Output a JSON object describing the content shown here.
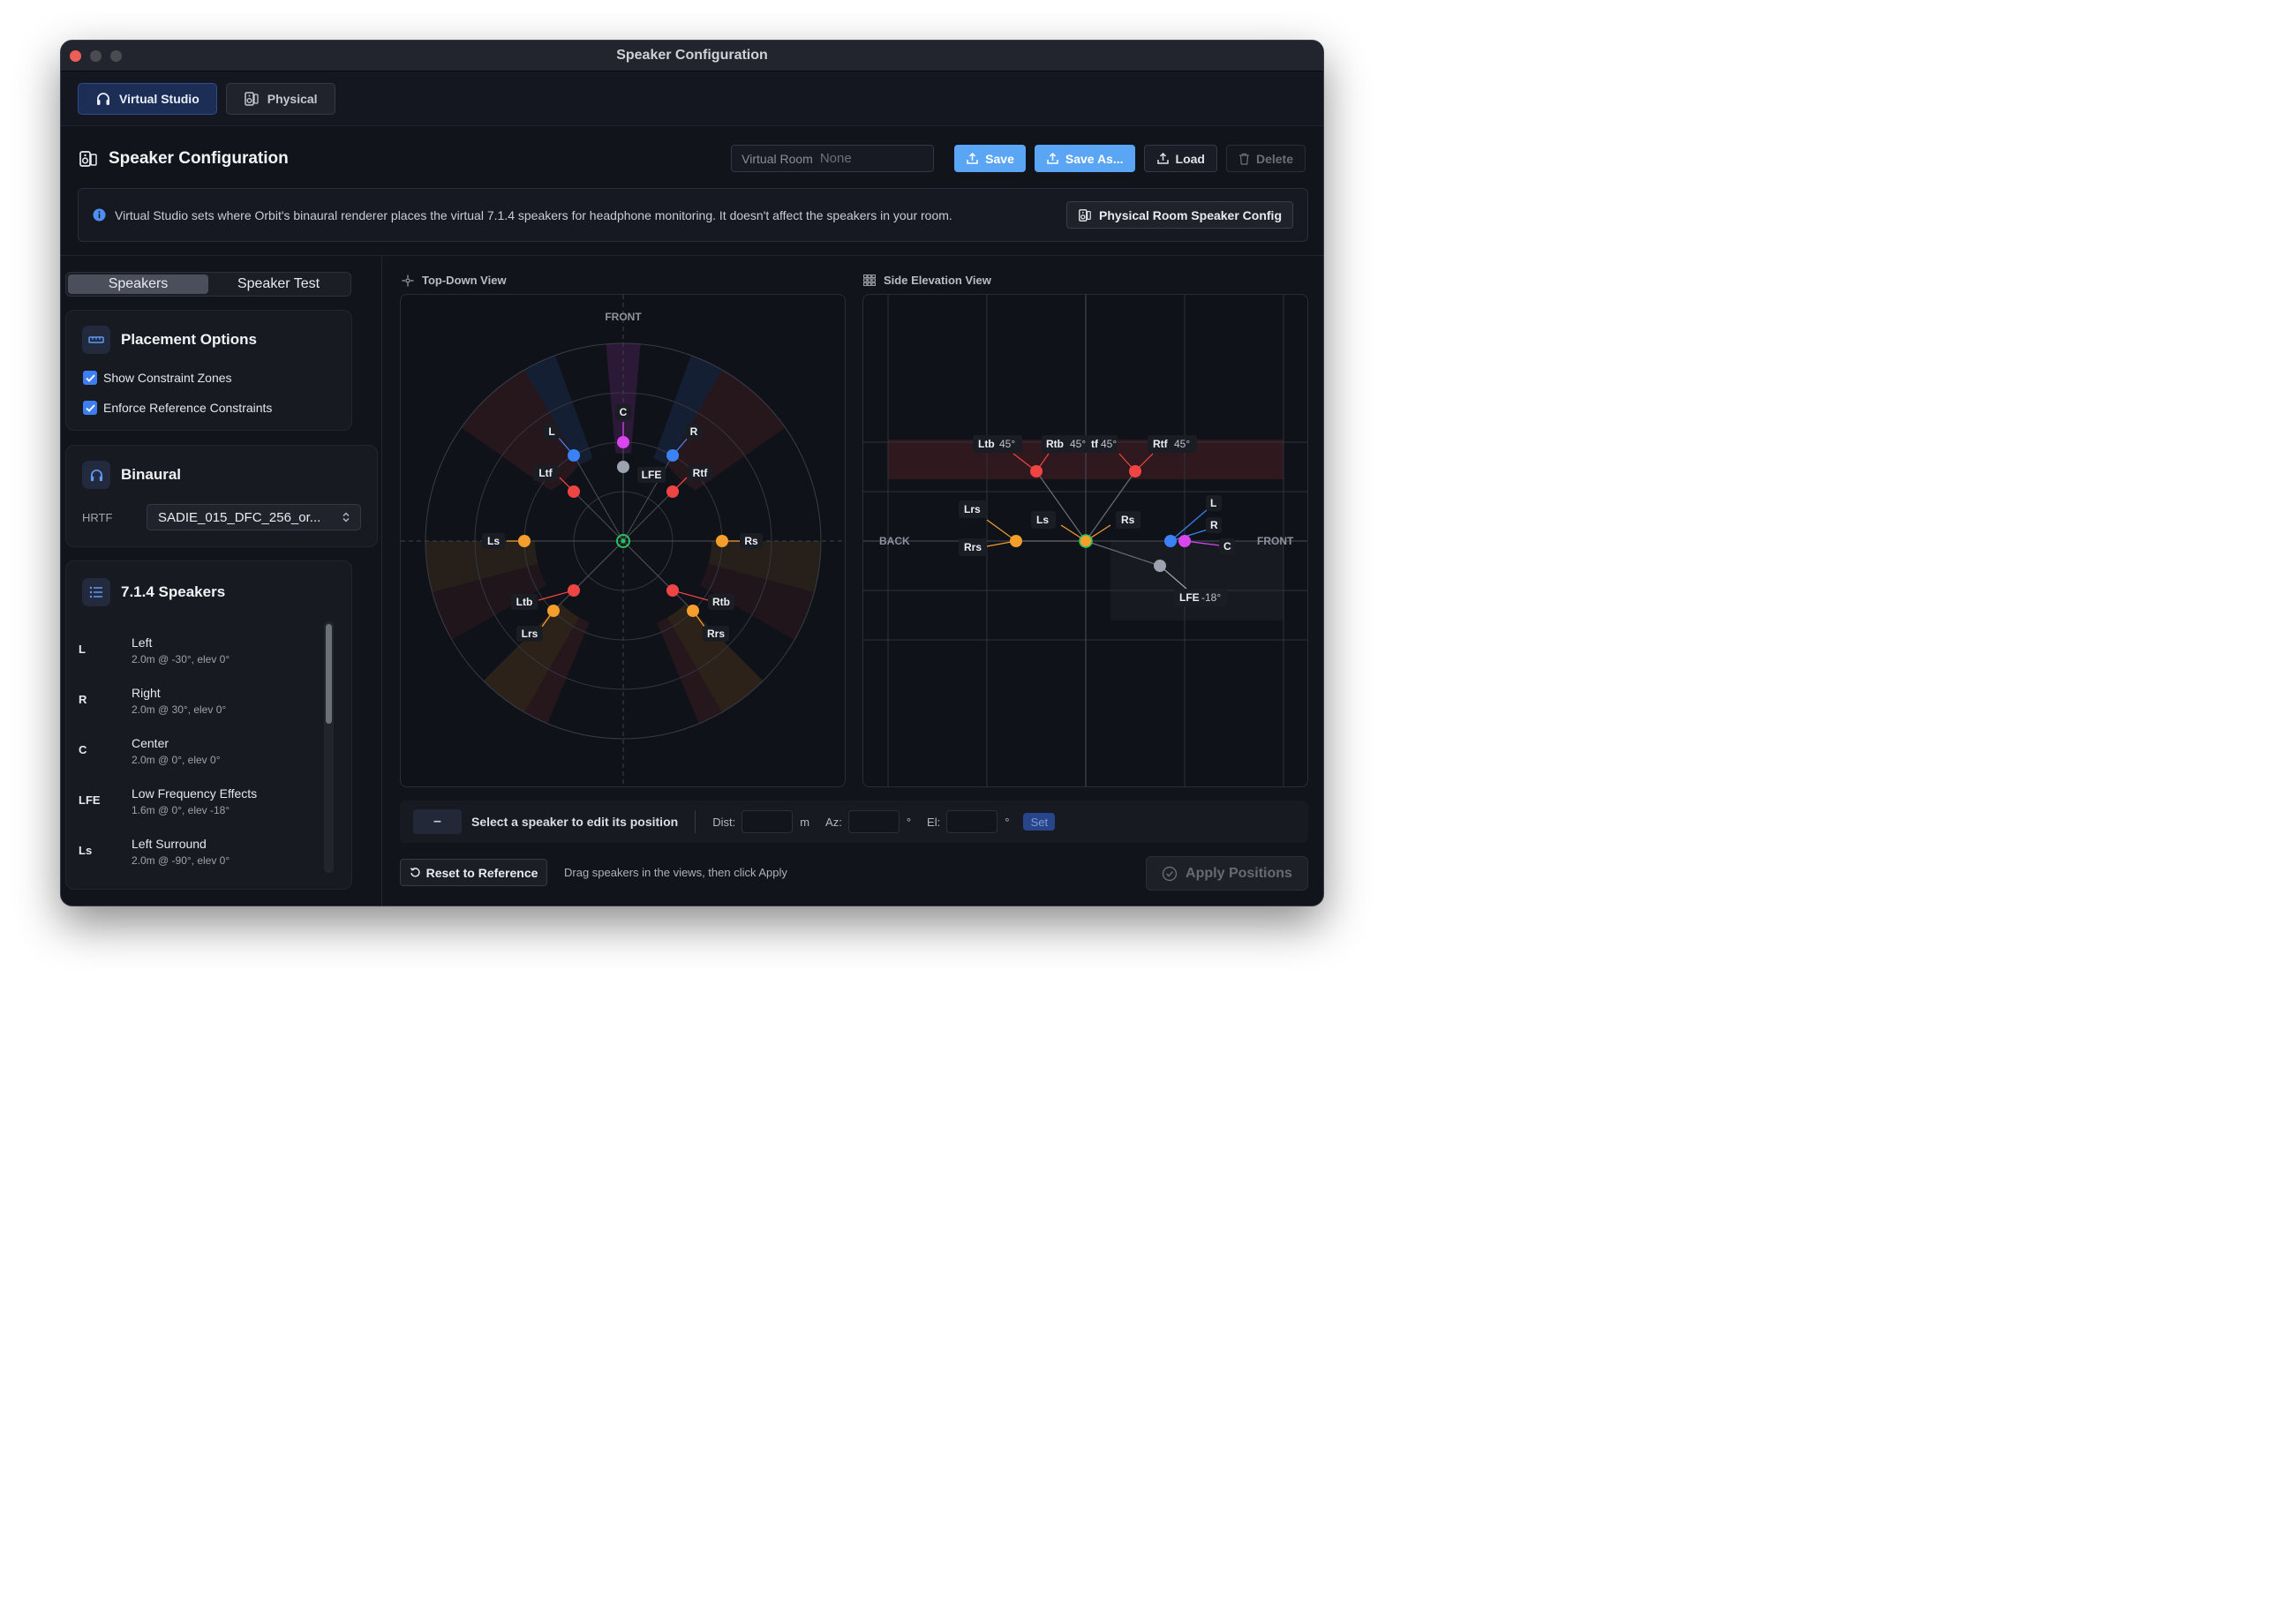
{
  "window": {
    "title": "Speaker Configuration"
  },
  "modes": [
    {
      "label": "Virtual Studio",
      "icon": "headphones-icon",
      "active": true
    },
    {
      "label": "Physical",
      "icon": "speaker-icon",
      "active": false
    }
  ],
  "header": {
    "title": "Speaker Configuration",
    "room_label": "Virtual Room",
    "room_value": "None",
    "save_label": "Save",
    "save_as_label": "Save As...",
    "load_label": "Load",
    "delete_label": "Delete"
  },
  "info": {
    "message": "Virtual Studio sets where Orbit's binaural renderer places the virtual 7.1.4 speakers for headphone monitoring. It doesn't affect the speakers in your room.",
    "button_label": "Physical Room Speaker Config"
  },
  "left_tabs": {
    "speakers": "Speakers",
    "test": "Speaker Test"
  },
  "placement": {
    "title": "Placement Options",
    "show_zones": "Show Constraint Zones",
    "enforce": "Enforce Reference Constraints"
  },
  "binaural": {
    "title": "Binaural",
    "hrtf_label": "HRTF",
    "hrtf_value": "SADIE_015_DFC_256_or..."
  },
  "speaker_list": {
    "title": "7.1.4 Speakers",
    "items": [
      {
        "code": "L",
        "name": "Left",
        "detail": "2.0m @ -30°, elev 0°"
      },
      {
        "code": "R",
        "name": "Right",
        "detail": "2.0m @ 30°, elev 0°"
      },
      {
        "code": "C",
        "name": "Center",
        "detail": "2.0m @ 0°, elev 0°"
      },
      {
        "code": "LFE",
        "name": "Low Frequency Effects",
        "detail": "1.6m @ 0°, elev -18°"
      },
      {
        "code": "Ls",
        "name": "Left Surround",
        "detail": "2.0m @ -90°, elev 0°"
      }
    ]
  },
  "top_view": {
    "label": "Top-Down View",
    "front": "FRONT",
    "labels": {
      "C": "C",
      "L": "L",
      "R": "R",
      "Ltf": "Ltf",
      "Rtf": "Rtf",
      "LFE": "LFE",
      "Ls": "Ls",
      "Rs": "Rs",
      "Ltb": "Ltb",
      "Rtb": "Rtb",
      "Lrs": "Lrs",
      "Rrs": "Rrs"
    }
  },
  "side_view": {
    "label": "Side Elevation View",
    "back": "BACK",
    "front": "FRONT",
    "labels": {
      "Ltb": "Ltb",
      "Ltb_deg": "45°",
      "Rtb": "Rtb",
      "Rtb_deg": "45°",
      "Ltf_partial": "tf",
      "Ltf_deg": "45°",
      "Rtf": "Rtf",
      "Rtf_deg": "45°",
      "Lrs": "Lrs",
      "Rrs": "Rrs",
      "Ls": "Ls",
      "Rs": "Rs",
      "L": "L",
      "R": "R",
      "C": "C",
      "LFE": "LFE",
      "LFE_deg": "-18°"
    }
  },
  "editor": {
    "placeholder_chip": "–",
    "message": "Select a speaker to edit its position",
    "dist_label": "Dist:",
    "dist_unit": "m",
    "az_label": "Az:",
    "az_unit": "°",
    "el_label": "El:",
    "el_unit": "°",
    "set_label": "Set"
  },
  "footer": {
    "reset_label": "Reset to Reference",
    "hint": "Drag speakers in the views, then click Apply",
    "apply_label": "Apply Positions"
  },
  "colors": {
    "front_lr": "#3b82f6",
    "center": "#d946ef",
    "lfe": "#9ca3af",
    "surround": "#f59e2b",
    "height": "#ef4444",
    "accent": "#5aa6f4"
  }
}
